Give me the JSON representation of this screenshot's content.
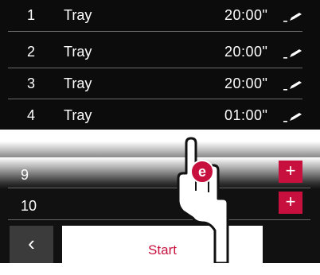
{
  "program_list": {
    "rows": [
      {
        "number": "1",
        "label": "Tray",
        "time": "20:00\""
      },
      {
        "number": "2",
        "label": "Tray",
        "time": "20:00\""
      },
      {
        "number": "3",
        "label": "Tray",
        "time": "20:00\""
      },
      {
        "number": "4",
        "label": "Tray",
        "time": "01:00\""
      }
    ],
    "edit_icon": "pencil-edit-icon"
  },
  "lower_list": {
    "rows": [
      {
        "number": "9",
        "action": "+"
      },
      {
        "number": "10",
        "action": "+"
      }
    ]
  },
  "footer": {
    "back_symbol": "‹",
    "start_label": "Start"
  },
  "overlay": {
    "badge_letter": "e"
  },
  "colors": {
    "accent": "#c8103e",
    "background": "#0c0c0c"
  }
}
